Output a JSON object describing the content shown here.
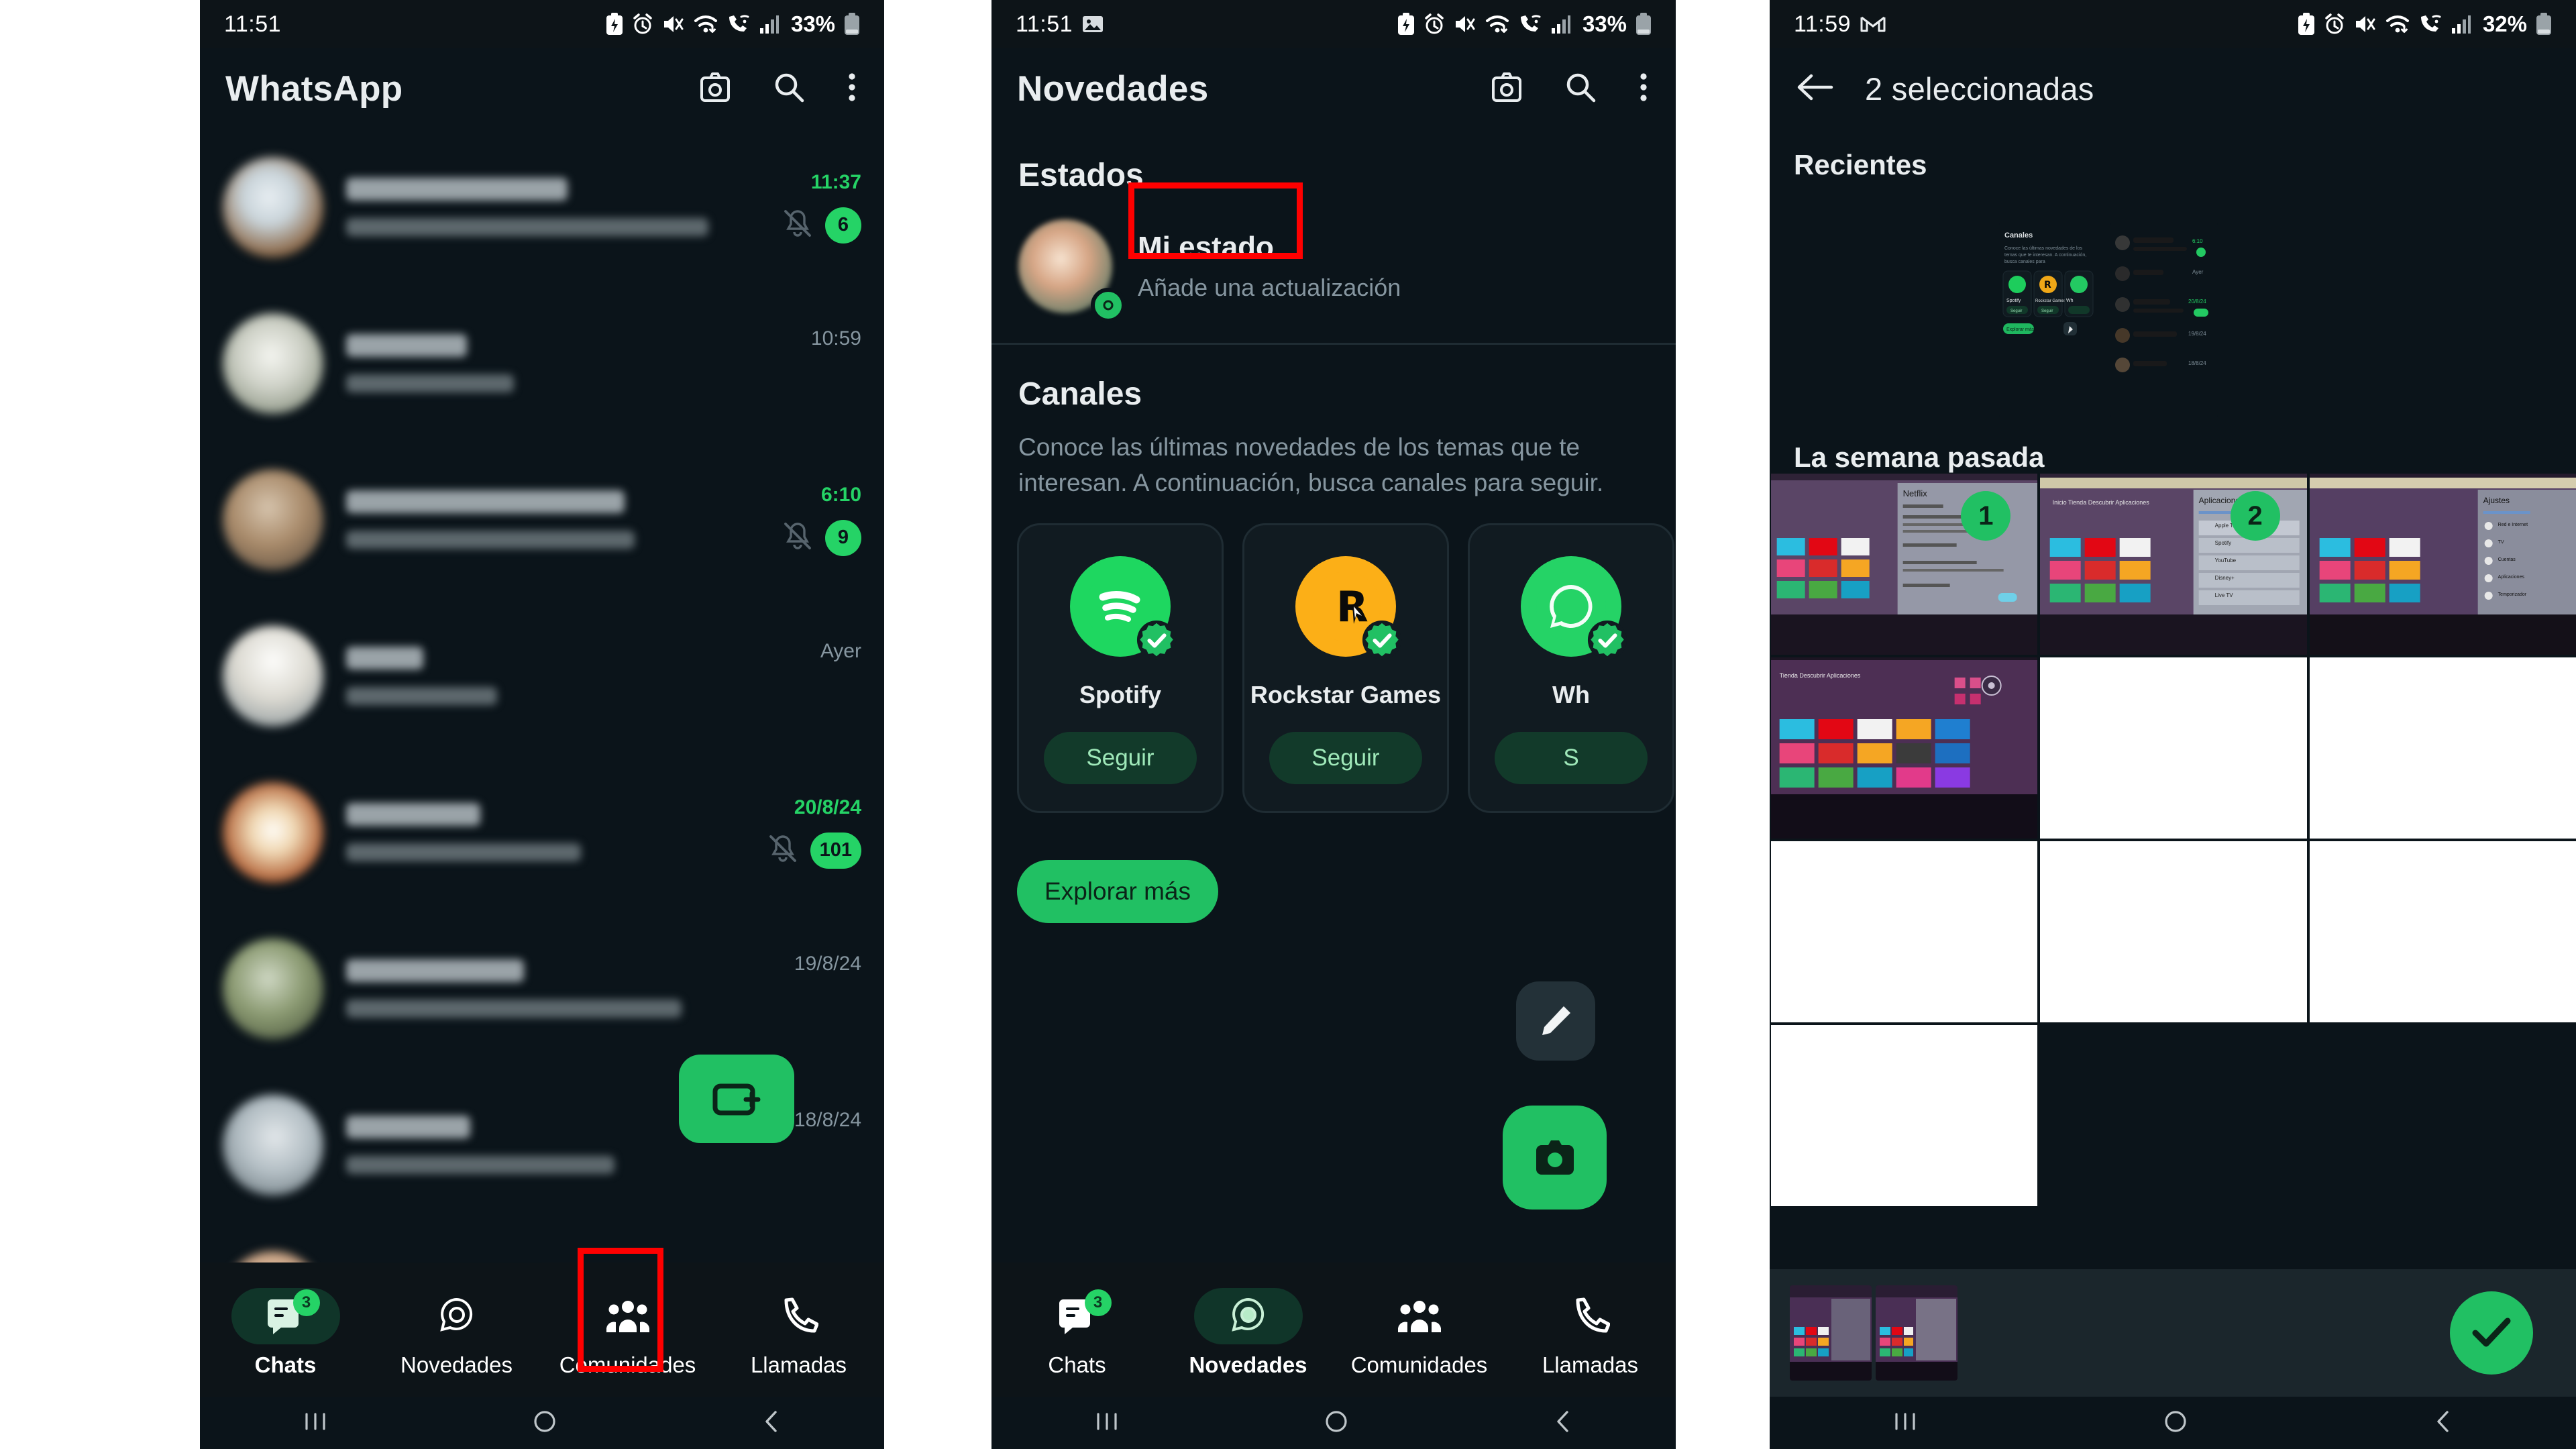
{
  "panel1": {
    "status": {
      "time": "11:51",
      "battery_pct": "33%",
      "icons": [
        "battery-saver-icon",
        "alarm-icon",
        "mute-icon",
        "wifi-icon",
        "wifi-calling-icon",
        "signal-icon",
        "battery-icon"
      ]
    },
    "appbar": {
      "title": "WhatsApp",
      "camera": "camera-icon",
      "search": "search-icon",
      "more": "more-vert-icon"
    },
    "chats": [
      {
        "time": "11:37",
        "unread": true,
        "muted": true,
        "badge": "6",
        "name_w": 330,
        "msg_w": 540
      },
      {
        "time": "10:59",
        "unread": false,
        "muted": false,
        "badge": "",
        "name_w": 180,
        "msg_w": 250
      },
      {
        "time": "6:10",
        "unread": true,
        "muted": true,
        "badge": "9",
        "name_w": 415,
        "msg_w": 430
      },
      {
        "time": "Ayer",
        "unread": false,
        "muted": false,
        "badge": "",
        "name_w": 115,
        "msg_w": 225
      },
      {
        "time": "20/8/24",
        "unread": true,
        "muted": true,
        "badge": "101",
        "name_w": 200,
        "msg_w": 350
      },
      {
        "time": "19/8/24",
        "unread": false,
        "muted": false,
        "badge": "",
        "name_w": 265,
        "msg_w": 500
      },
      {
        "time": "18/8/24",
        "unread": false,
        "muted": false,
        "badge": "",
        "name_w": 185,
        "msg_w": 400
      },
      {
        "time": "",
        "unread": false,
        "muted": false,
        "badge": "",
        "name_w": 300,
        "msg_w": 490
      }
    ],
    "fab": "new-chat-icon",
    "nav": [
      {
        "label": "Chats",
        "icon": "chats-icon",
        "active": true,
        "badge": "3",
        "highlight": false
      },
      {
        "label": "Novedades",
        "icon": "status-icon",
        "active": false,
        "badge": "",
        "highlight": true
      },
      {
        "label": "Comunidades",
        "icon": "communities-icon",
        "active": false,
        "badge": "",
        "highlight": false
      },
      {
        "label": "Llamadas",
        "icon": "calls-icon",
        "active": false,
        "badge": "",
        "highlight": false
      }
    ]
  },
  "panel2": {
    "status": {
      "time": "11:51",
      "battery_pct": "33%",
      "photo_icon": "photo-icon"
    },
    "appbar": {
      "title": "Novedades",
      "camera": "camera-icon",
      "search": "search-icon",
      "more": "more-vert-icon"
    },
    "estados": {
      "heading": "Estados",
      "my_status": "Mi estado",
      "my_status_sub": "Añade una actualización"
    },
    "canales": {
      "heading": "Canales",
      "description": "Conoce las últimas novedades de los temas que te interesan. A continuación, busca canales para seguir.",
      "cards": [
        {
          "name": "Spotify",
          "follow": "Seguir",
          "logo": "spotify-logo"
        },
        {
          "name": "Rockstar Games",
          "follow": "Seguir",
          "logo": "rockstar-logo"
        },
        {
          "name": "Wh",
          "follow": "S",
          "logo": "whatsapp-logo"
        }
      ],
      "explore": "Explorar más"
    },
    "fabs": {
      "edit": "pencil-icon",
      "camera": "camera-icon"
    },
    "nav": [
      {
        "label": "Chats",
        "icon": "chats-icon",
        "active": false,
        "badge": "3",
        "highlight": false
      },
      {
        "label": "Novedades",
        "icon": "status-icon",
        "active": true,
        "badge": "",
        "highlight": false
      },
      {
        "label": "Comunidades",
        "icon": "communities-icon",
        "active": false,
        "badge": "",
        "highlight": false
      },
      {
        "label": "Llamadas",
        "icon": "calls-icon",
        "active": false,
        "badge": "",
        "highlight": false
      }
    ]
  },
  "panel3": {
    "status": {
      "time": "11:59",
      "battery_pct": "32%",
      "gmail_icon": "gmail-icon"
    },
    "appbar": {
      "back": "back-arrow-icon",
      "title": "2 seleccionadas"
    },
    "sections": {
      "recientes": "Recientes",
      "semana": "La semana pasada"
    },
    "selection": {
      "first": "1",
      "second": "2"
    },
    "confirm": "check-icon",
    "highlight_color": "#ff0000",
    "accent_color": "#21c063"
  },
  "redboxes": {
    "note": "red-highlight-rectangle"
  }
}
